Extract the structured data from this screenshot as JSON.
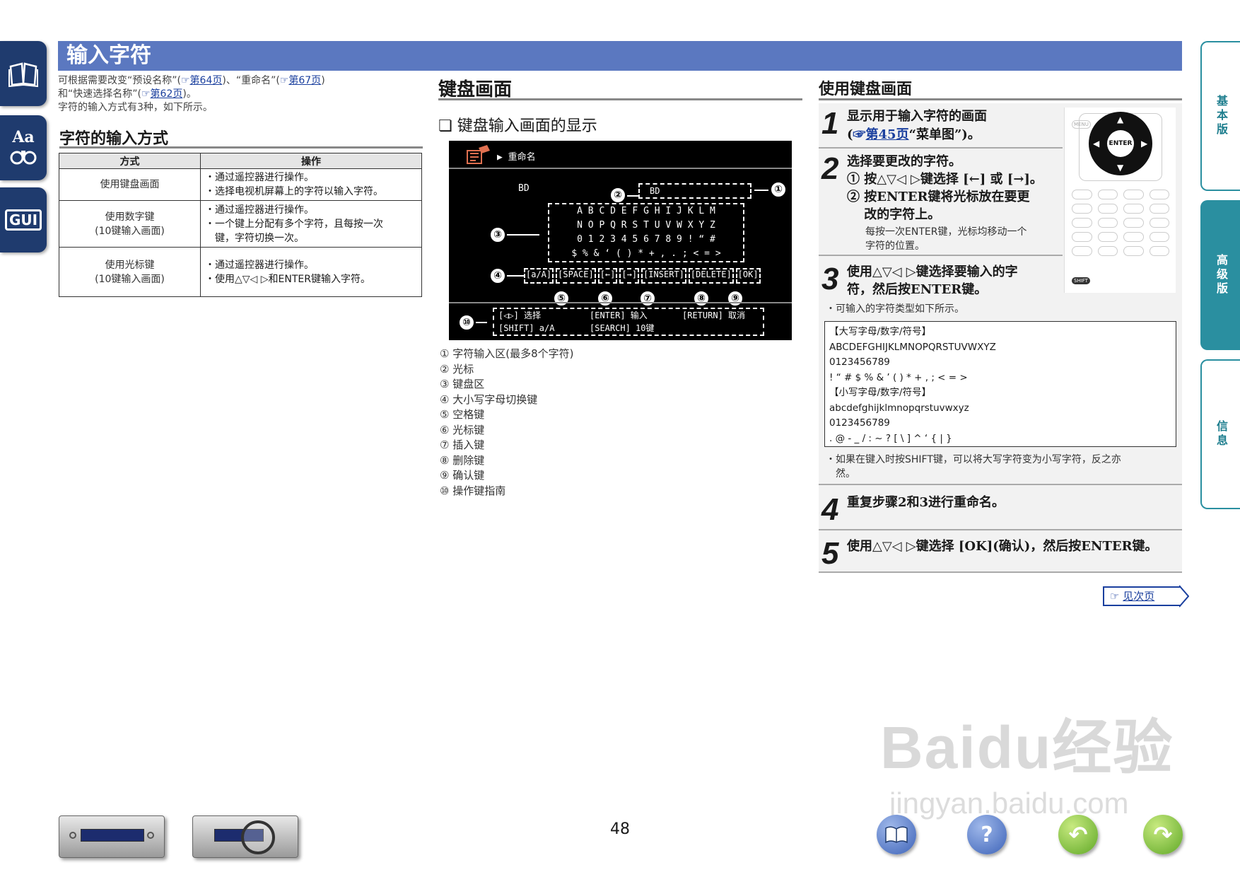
{
  "page_number": "48",
  "header": {
    "title": "输入字符"
  },
  "left_tabs": [
    {
      "label": "Aa"
    },
    {
      "label": "GUI"
    }
  ],
  "right_tabs": [
    {
      "label": "基本版"
    },
    {
      "label": "高级版"
    },
    {
      "label": "信息"
    }
  ],
  "intro": {
    "line1_a": "可根据需要改变“预设名称”(",
    "link1": "第64页",
    "line1_b": ")、“重命名”(",
    "link2": "第67页",
    "line1_c": ")",
    "line2_a": "和“快速选择名称”(",
    "link3": "第62页",
    "line2_b": ")。",
    "line3": "字符的输入方式有3种，如下所示。"
  },
  "input_methods": {
    "heading": "字符的输入方式",
    "columns": [
      "方式",
      "操作"
    ],
    "rows": [
      {
        "method": "使用键盘画面",
        "ops": [
          "・通过遥控器进行操作。",
          "・选择电视机屏幕上的字符以输入字符。"
        ]
      },
      {
        "method": "使用数字键\n(10键输入画面)",
        "ops": [
          "・通过遥控器进行操作。",
          "・一个键上分配有多个字符，且每按一次",
          "　键，字符切换一次。"
        ]
      },
      {
        "method": "使用光标键\n(10键输入画面)",
        "ops": [
          "・通过遥控器进行操作。",
          "・使用△▽◁ ▷和ENTER键输入字符。"
        ]
      }
    ]
  },
  "keyboard": {
    "heading": "键盘画面",
    "subheading": "❏ 键盘输入画面的显示",
    "screen": {
      "menu_title": "▶ 重命名",
      "source": "BD",
      "input_value": "BD",
      "rows": [
        "A B C D E F G H I J K L M",
        "N O P Q R S T U V W X Y Z",
        "0 1 2 3 4 5 6 7 8 9 ! “ #",
        "$ % & ‘ ( ) * + , . ; < = >"
      ],
      "buttons": [
        "[a/A]",
        "[SPACE]",
        "[←]",
        "[→]",
        "[INSERT]",
        "[DELETE]",
        "[OK]"
      ],
      "guide_line1_a": "[◁▷] 选择",
      "guide_line1_b": "[ENTER] 输入",
      "guide_line1_c": "[RETURN] 取消",
      "guide_line2_a": "[SHIFT] a/A",
      "guide_line2_b": "[SEARCH] 10键"
    },
    "legend": [
      "① 字符输入区(最多8个字符)",
      "② 光标",
      "③ 键盘区",
      "④ 大小写字母切换键",
      "⑤ 空格键",
      "⑥ 光标键",
      "⑦ 插入键",
      "⑧ 删除键",
      "⑨ 确认键",
      "⑩ 操作键指南"
    ]
  },
  "using": {
    "heading": "使用键盘画面",
    "step1_title": "显示用于输入字符的画面",
    "step1_sub_a": "(",
    "step1_link": "第45页",
    "step1_sub_b": "“菜单图”)。",
    "step2_title": "选择要更改的字符。",
    "step2_a": "① 按△▽◁ ▷键选择 [←] 或 [→]。",
    "step2_b": "② 按ENTER键将光标放在要更",
    "step2_c": "　 改的字符上。",
    "step2_note1": "每按一次ENTER键，光标均移动一个",
    "step2_note2": "字符的位置。",
    "step3_title1": "使用△▽◁ ▷键选择要输入的字",
    "step3_title2": "符，然后按ENTER键。",
    "step3_note": "・可输入的字符类型如下所示。",
    "char_box": [
      "【大写字母/数字/符号】",
      "ABCDEFGHIJKLMNOPQRSTUVWXYZ",
      "0123456789",
      "! “ # $ % & ’ ( ) * + , ; < = >",
      "【小写字母/数字/符号】",
      "abcdefghijklmnopqrstuvwxyz",
      "0123456789",
      ". @ - _ / : ~ ? [ \\ ] ^ ‘ { | }"
    ],
    "shift_note1": "・如果在键入时按SHIFT键，可以将大写字符变为小写字符，反之亦",
    "shift_note2": "　然。",
    "step4_title": "重复步骤2和3进行重命名。",
    "step5_title": "使用△▽◁ ▷键选择 [OK](确认)，然后按ENTER键。",
    "next_page": "见次页"
  },
  "remote": {
    "enter": "ENTER",
    "menu": "MENU",
    "shift": "SHIFT"
  },
  "watermark": {
    "line1": "Baidu经验",
    "line2": "jingyan.baidu.com"
  },
  "colors": {
    "header_blue": "#5b78c0",
    "tab_navy": "#1f3b6e",
    "teal": "#2a8fa0",
    "link_blue": "#1a3f9e"
  }
}
